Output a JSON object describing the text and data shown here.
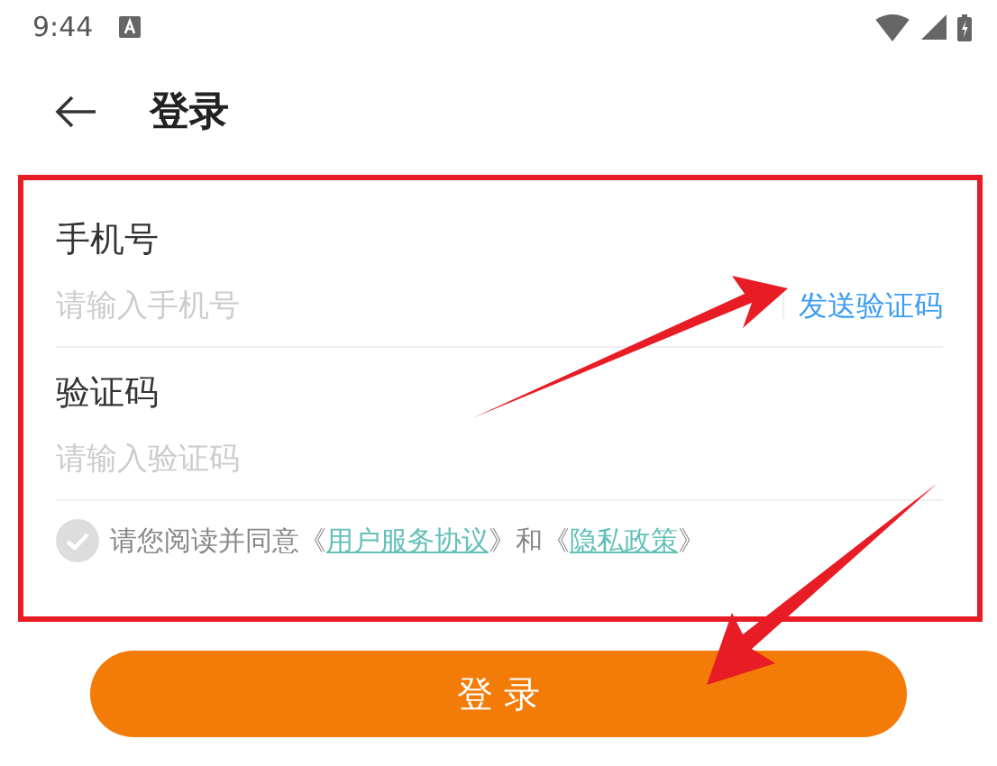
{
  "status_bar": {
    "time": "9:44"
  },
  "header": {
    "title": "登录"
  },
  "fields": [
    {
      "label": "手机号",
      "placeholder": "请输入手机号",
      "action": "发送验证码"
    },
    {
      "label": "验证码",
      "placeholder": "请输入验证码"
    }
  ],
  "agreement": {
    "checked": false,
    "parts": [
      {
        "kind": "text",
        "text": "请您阅读并同意《"
      },
      {
        "kind": "link",
        "text": "用户服务协议"
      },
      {
        "kind": "text",
        "text": "》和《"
      },
      {
        "kind": "link",
        "text": "隐私政策"
      },
      {
        "kind": "text",
        "text": "》"
      }
    ]
  },
  "login_button": "登 录"
}
